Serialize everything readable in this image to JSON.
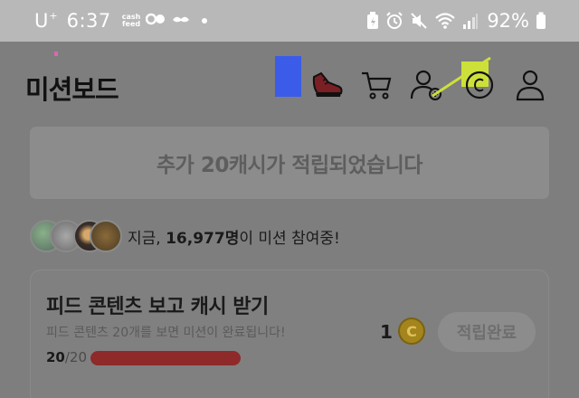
{
  "status_bar": {
    "carrier": "U",
    "carrier_sup": "+",
    "time": "6:37",
    "cashfeed_line1": "cash",
    "cashfeed_line2": "feed",
    "battery_percent": "92%"
  },
  "header": {
    "title": "미션보드"
  },
  "banner": {
    "text": "추가 20캐시가 적립되었습니다"
  },
  "participants": {
    "prefix": "지금, ",
    "count": "16,977명",
    "suffix": "이 미션 참여중!"
  },
  "mission": {
    "title": "피드 콘텐츠 보고 캐시 받기",
    "description": "피드 콘텐츠 20개를 보면 미션이 완료됩니다!",
    "progress_current": "20",
    "progress_total": "/20",
    "progress_fraction": 1.0,
    "reward_count": "1",
    "coin_symbol": "C",
    "button_label": "적립완료"
  },
  "colors": {
    "blue_marker": "#3a5ce8",
    "yellow_marker": "#cde03a",
    "progress_fill": "#8e2a2a"
  },
  "icons": [
    "shoe-icon",
    "cart-icon",
    "add-friend-icon",
    "coin-history-icon",
    "profile-icon"
  ]
}
